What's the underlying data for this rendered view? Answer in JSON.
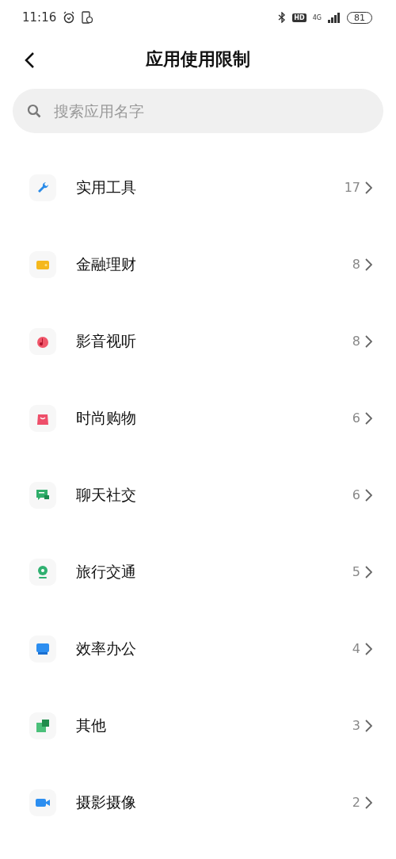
{
  "status_bar": {
    "time": "11:16",
    "hd": "HD",
    "network": "4G",
    "battery": "81"
  },
  "header": {
    "title": "应用使用限制"
  },
  "search": {
    "placeholder": "搜索应用名字"
  },
  "categories": [
    {
      "name": "实用工具",
      "count": "17"
    },
    {
      "name": "金融理财",
      "count": "8"
    },
    {
      "name": "影音视听",
      "count": "8"
    },
    {
      "name": "时尚购物",
      "count": "6"
    },
    {
      "name": "聊天社交",
      "count": "6"
    },
    {
      "name": "旅行交通",
      "count": "5"
    },
    {
      "name": "效率办公",
      "count": "4"
    },
    {
      "name": "其他",
      "count": "3"
    },
    {
      "name": "摄影摄像",
      "count": "2"
    }
  ]
}
